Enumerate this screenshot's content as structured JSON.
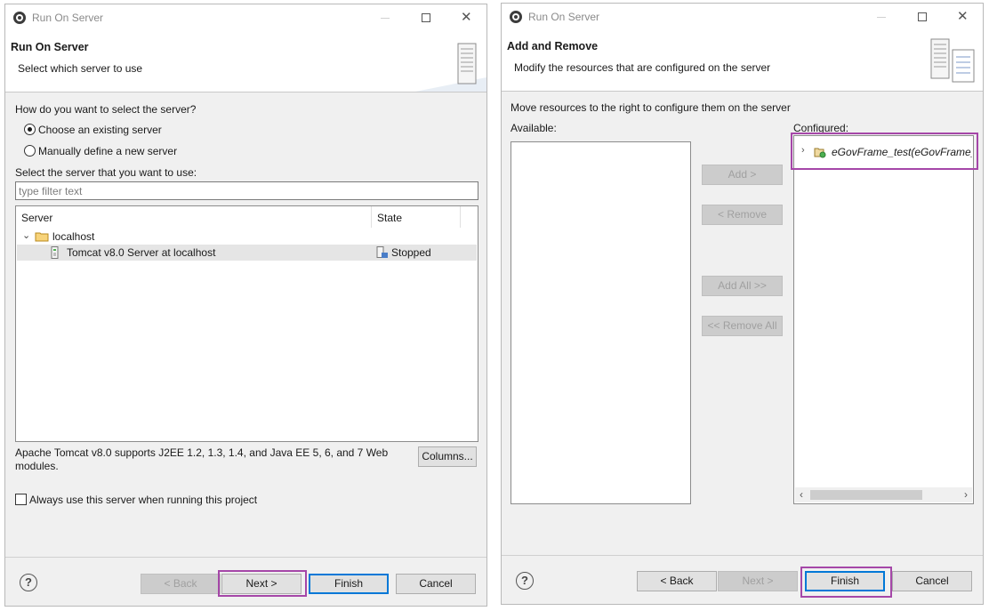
{
  "dialog1": {
    "window_title": "Run On Server",
    "banner_title": "Run On Server",
    "banner_desc": "Select which server to use",
    "question": "How do you want to select the server?",
    "radio_existing": "Choose an existing server",
    "radio_manual": "Manually define a new server",
    "select_label": "Select the server that you want to use:",
    "filter_placeholder": "type filter text",
    "columns": {
      "server": "Server",
      "state": "State"
    },
    "tree": {
      "group": "localhost",
      "server_name": "Tomcat v8.0 Server at localhost",
      "server_state": "Stopped"
    },
    "description": "Apache Tomcat v8.0 supports J2EE 1.2, 1.3, 1.4, and Java EE 5, 6, and 7 Web modules.",
    "columns_button": "Columns...",
    "always_use": "Always use this server when running this project",
    "buttons": {
      "back": "< Back",
      "next": "Next >",
      "finish": "Finish",
      "cancel": "Cancel"
    },
    "help": "?"
  },
  "dialog2": {
    "window_title": "Run On Server",
    "banner_title": "Add and Remove",
    "banner_desc": "Modify the resources that are configured on the server",
    "instruction": "Move resources to the right to configure them on the server",
    "available_label": "Available:",
    "configured_label": "Configured:",
    "configured_item": "eGovFrame_test(eGovFrame_t",
    "move_buttons": {
      "add": "Add >",
      "remove": "< Remove",
      "add_all": "Add All >>",
      "remove_all": "<< Remove All"
    },
    "buttons": {
      "back": "< Back",
      "next": "Next >",
      "finish": "Finish",
      "cancel": "Cancel"
    },
    "help": "?"
  },
  "colors": {
    "highlight": "#a547a8",
    "default_button": "#0078d7",
    "selection": "#e5e5e5"
  },
  "icons": [
    "app-gear-icon",
    "server-tower-icon",
    "folder-icon",
    "server-small-icon",
    "stopped-state-icon",
    "project-icon",
    "help-icon"
  ]
}
